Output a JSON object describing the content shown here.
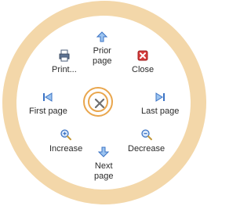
{
  "menu": {
    "center": {
      "icon": "close-x-icon"
    },
    "items": [
      {
        "key": "prior-page",
        "label_lines": [
          "Prior",
          "page"
        ],
        "icon": "arrow-up-icon"
      },
      {
        "key": "close",
        "label_lines": [
          "Close",
          ""
        ],
        "icon": "close-red-icon"
      },
      {
        "key": "print",
        "label_lines": [
          "Print...",
          ""
        ],
        "icon": "printer-icon"
      },
      {
        "key": "first-page",
        "label_lines": [
          "First page",
          ""
        ],
        "icon": "first-page-icon"
      },
      {
        "key": "last-page",
        "label_lines": [
          "Last page",
          ""
        ],
        "icon": "last-page-icon"
      },
      {
        "key": "increase",
        "label_lines": [
          "Increase",
          ""
        ],
        "icon": "zoom-in-icon"
      },
      {
        "key": "decrease",
        "label_lines": [
          "Decrease",
          ""
        ],
        "icon": "zoom-out-icon"
      },
      {
        "key": "next-page",
        "label_lines": [
          "Next",
          "page"
        ],
        "icon": "arrow-down-icon"
      }
    ]
  },
  "colors": {
    "ring": "#f3d7a9",
    "accent": "#e9a64d",
    "blue_icon": "#4a86d8",
    "red_icon": "#d53b3b"
  }
}
